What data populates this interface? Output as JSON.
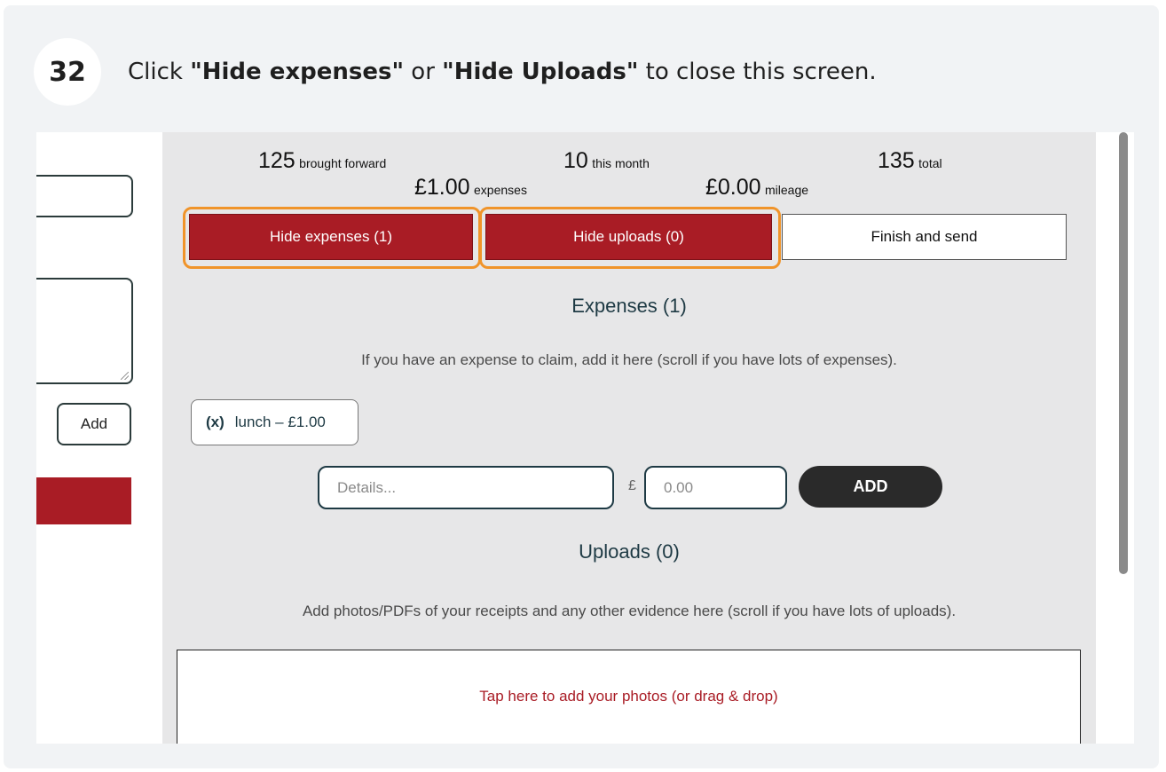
{
  "step": {
    "number": "32",
    "text_before": "Click ",
    "bold1": "\"Hide expenses\"",
    "text_mid": " or ",
    "bold2": "\"Hide Uploads\"",
    "text_after": " to close this screen."
  },
  "left_pane": {
    "add_label": "Add"
  },
  "stats": {
    "brought_forward_value": "125",
    "brought_forward_label": "brought forward",
    "this_month_value": "10",
    "this_month_label": "this month",
    "total_value": "135",
    "total_label": "total",
    "expenses_value": "£1.00",
    "expenses_label": "expenses",
    "mileage_value": "£0.00",
    "mileage_label": "mileage"
  },
  "tabs": {
    "hide_expenses": "Hide expenses (1)",
    "hide_uploads": "Hide uploads (0)",
    "finish_send": "Finish and send"
  },
  "expenses": {
    "heading": "Expenses (1)",
    "note": "If you have an expense to claim, add it here (scroll if you have lots of expenses).",
    "items": [
      {
        "remove": "(x)",
        "label": "lunch – £1.00"
      }
    ],
    "details_placeholder": "Details...",
    "currency_symbol": "£",
    "amount_placeholder": "0.00",
    "add_button": "ADD"
  },
  "uploads": {
    "heading": "Uploads (0)",
    "note": "Add photos/PDFs of your receipts and any other evidence here (scroll if you have lots of uploads).",
    "dropzone_text": "Tap here to add your photos (or drag & drop)"
  },
  "colors": {
    "brand_red": "#a91c25",
    "highlight_orange": "#f0942a",
    "heading_teal": "#1e3a44",
    "add_button_bg": "#2a2a2a"
  }
}
